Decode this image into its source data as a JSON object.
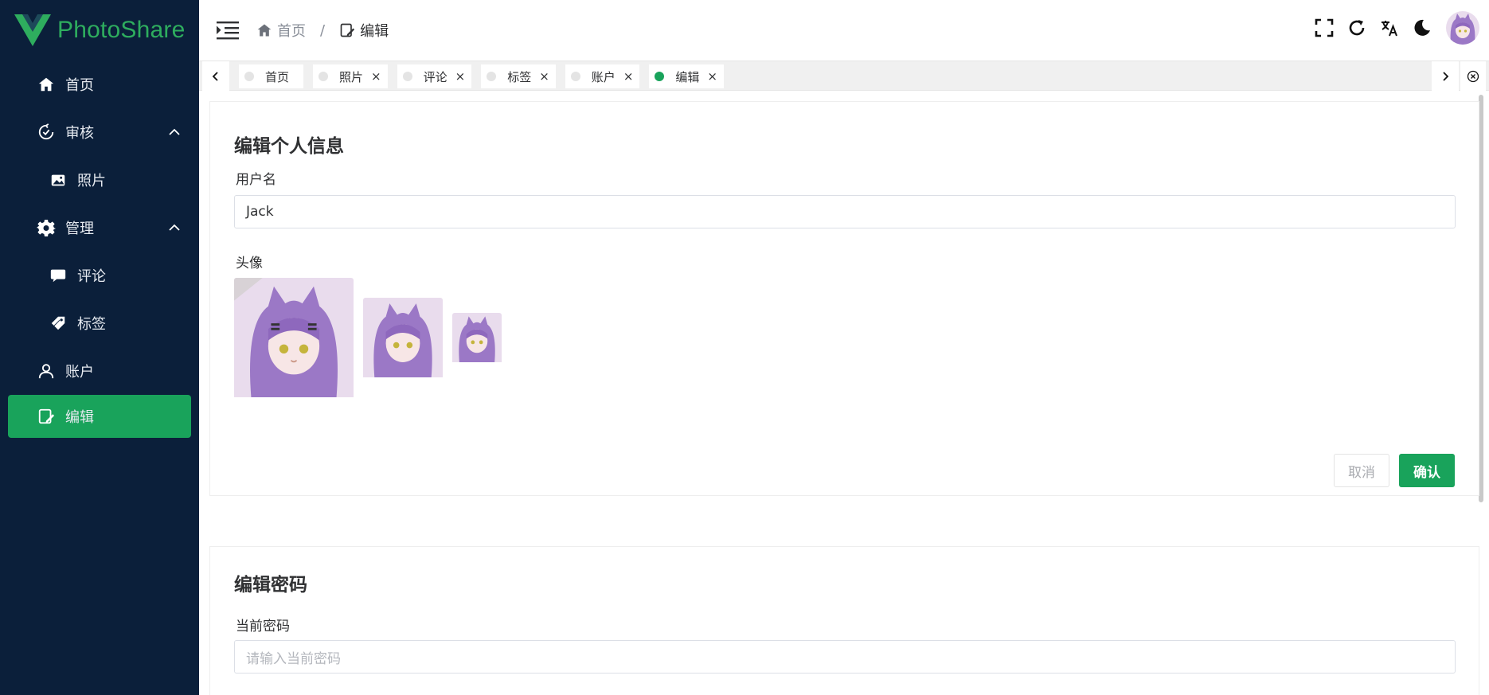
{
  "app": {
    "brand": "PhotoShare"
  },
  "sidebar": {
    "items": [
      {
        "label": "首页",
        "icon": "home-icon"
      },
      {
        "label": "审核",
        "icon": "refresh-check-icon",
        "expanded": true
      },
      {
        "label": "照片",
        "icon": "image-icon"
      },
      {
        "label": "管理",
        "icon": "gear-icon",
        "expanded": true
      },
      {
        "label": "评论",
        "icon": "comment-icon"
      },
      {
        "label": "标签",
        "icon": "tag-icon"
      },
      {
        "label": "账户",
        "icon": "user-icon"
      },
      {
        "label": "编辑",
        "icon": "edit-icon",
        "active": true
      }
    ]
  },
  "breadcrumb": {
    "home": "首页",
    "separator": "/",
    "current": "编辑"
  },
  "tabs": [
    {
      "label": "首页",
      "closable": false,
      "active": false
    },
    {
      "label": "照片",
      "closable": true,
      "active": false
    },
    {
      "label": "评论",
      "closable": true,
      "active": false
    },
    {
      "label": "标签",
      "closable": true,
      "active": false
    },
    {
      "label": "账户",
      "closable": true,
      "active": false
    },
    {
      "label": "编辑",
      "closable": true,
      "active": true
    }
  ],
  "tab_close_glyph": "×",
  "profile_form": {
    "title": "编辑个人信息",
    "username_label": "用户名",
    "username_value": "Jack",
    "avatar_label": "头像",
    "cancel_label": "取消",
    "confirm_label": "确认"
  },
  "password_form": {
    "title": "编辑密码",
    "current_password_label": "当前密码",
    "current_password_placeholder": "请输入当前密码"
  },
  "colors": {
    "sidebar_bg": "#0b1f3a",
    "accent": "#19a35b",
    "brand": "#2ead5e"
  }
}
